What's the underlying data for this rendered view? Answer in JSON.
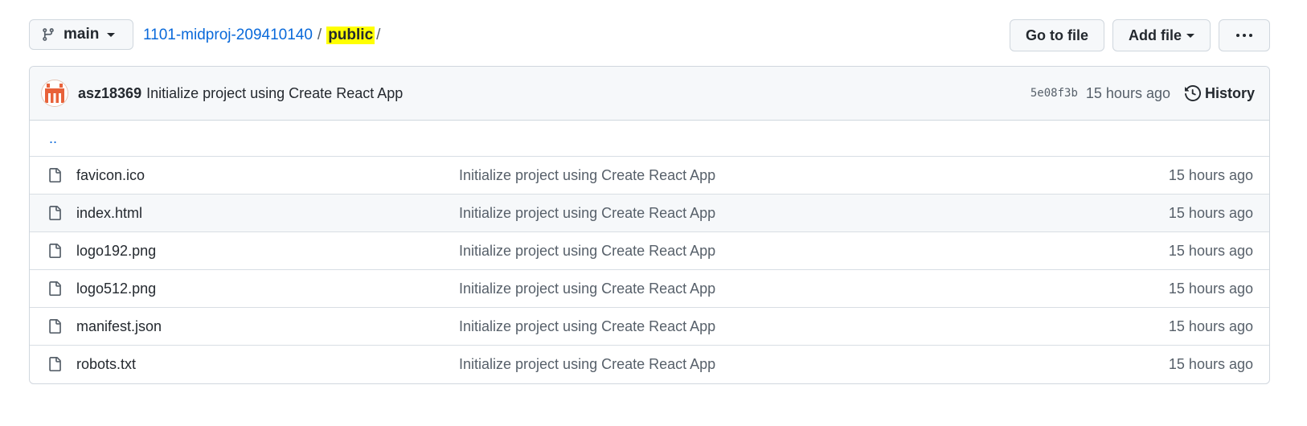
{
  "branch": {
    "name": "main",
    "icon": "git-branch-icon"
  },
  "breadcrumb": {
    "repo": "1101-midproj-209410140",
    "separator": "/",
    "folder": "public",
    "trailing_sep": "/"
  },
  "actions": {
    "go_to_file": "Go to file",
    "add_file": "Add file",
    "more_icon": "kebab-horizontal-icon"
  },
  "latest_commit": {
    "author": "asz18369",
    "message": "Initialize project using Create React App",
    "sha": "5e08f3b",
    "time": "15 hours ago",
    "history_label": "History"
  },
  "parent_link": "..",
  "files": [
    {
      "name": "favicon.ico",
      "message": "Initialize project using Create React App",
      "age": "15 hours ago"
    },
    {
      "name": "index.html",
      "message": "Initialize project using Create React App",
      "age": "15 hours ago"
    },
    {
      "name": "logo192.png",
      "message": "Initialize project using Create React App",
      "age": "15 hours ago"
    },
    {
      "name": "logo512.png",
      "message": "Initialize project using Create React App",
      "age": "15 hours ago"
    },
    {
      "name": "manifest.json",
      "message": "Initialize project using Create React App",
      "age": "15 hours ago"
    },
    {
      "name": "robots.txt",
      "message": "Initialize project using Create React App",
      "age": "15 hours ago"
    }
  ],
  "colors": {
    "link": "#0969da",
    "highlight": "#ffff00",
    "muted": "#57606a",
    "border": "#d0d7de"
  }
}
